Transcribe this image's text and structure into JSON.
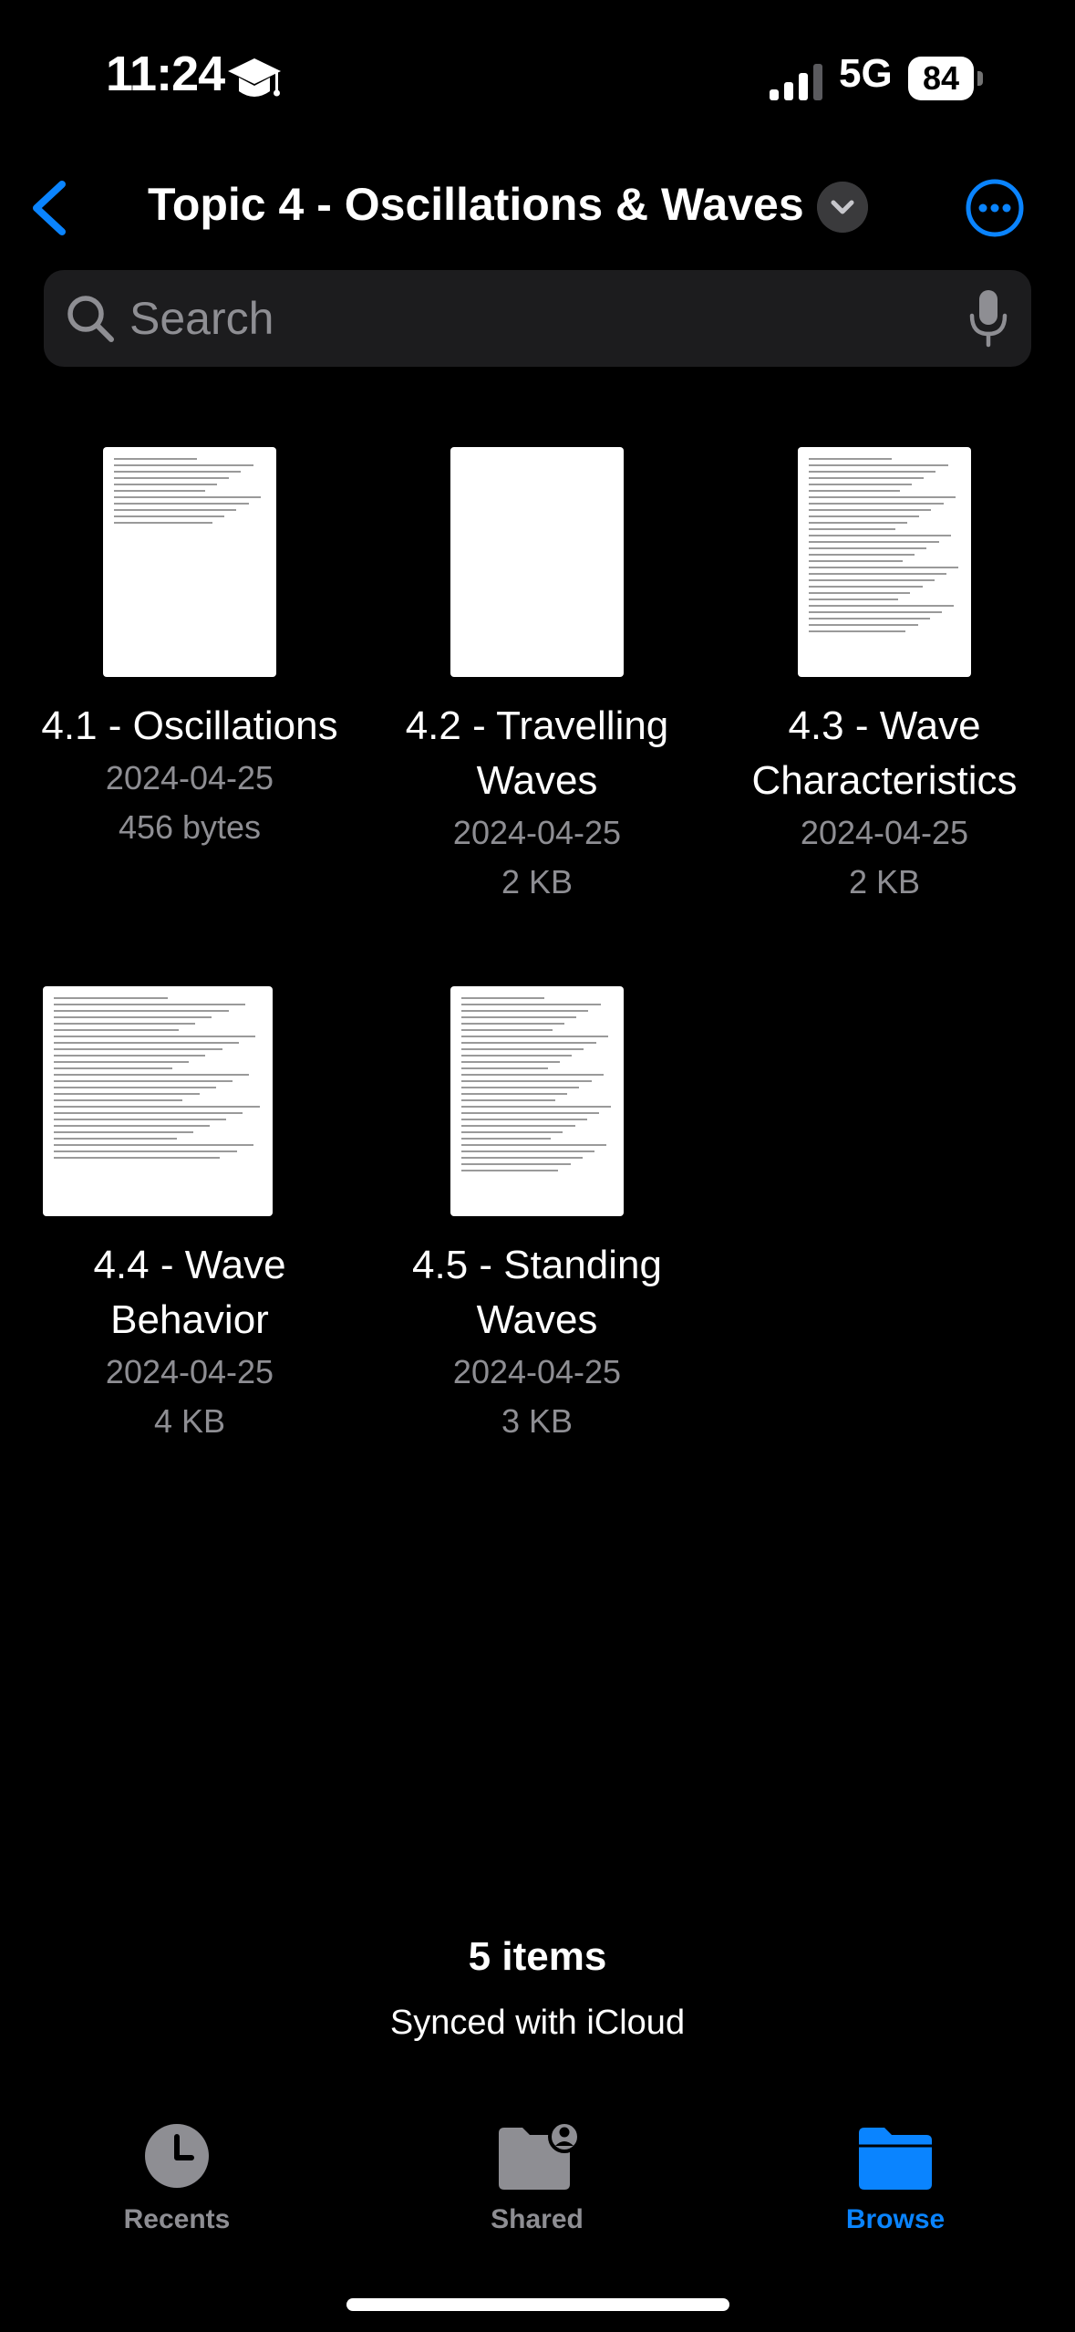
{
  "status_bar": {
    "time": "11:24",
    "network": "5G",
    "battery": "84"
  },
  "nav": {
    "title": "Topic 4 - Oscillations & Waves"
  },
  "search": {
    "placeholder": "Search"
  },
  "files": [
    {
      "name": "4.1 - Oscillations",
      "date": "2024-04-25",
      "size": "456 bytes",
      "thumb": "portrait",
      "thumb_lines": 11
    },
    {
      "name": "4.2 - Travelling Waves",
      "date": "2024-04-25",
      "size": "2 KB",
      "thumb": "portrait",
      "thumb_lines": 0
    },
    {
      "name": "4.3 - Wave Characteristics",
      "date": "2024-04-25",
      "size": "2 KB",
      "thumb": "portrait",
      "thumb_lines": 28
    },
    {
      "name": "4.4 - Wave Behavior",
      "date": "2024-04-25",
      "size": "4 KB",
      "thumb": "landscape",
      "thumb_lines": 26
    },
    {
      "name": "4.5 - Standing Waves",
      "date": "2024-04-25",
      "size": "3 KB",
      "thumb": "portrait",
      "thumb_lines": 28
    }
  ],
  "footer": {
    "items_count": "5 items",
    "sync_status": "Synced with iCloud"
  },
  "tabs": [
    {
      "label": "Recents",
      "icon": "clock-icon",
      "active": false
    },
    {
      "label": "Shared",
      "icon": "shared-folder-icon",
      "active": false
    },
    {
      "label": "Browse",
      "icon": "folder-icon",
      "active": true
    }
  ],
  "colors": {
    "accent": "#0a84ff",
    "background": "#000000",
    "secondary_text": "#8e8e93",
    "search_bg": "#1c1c1e"
  }
}
